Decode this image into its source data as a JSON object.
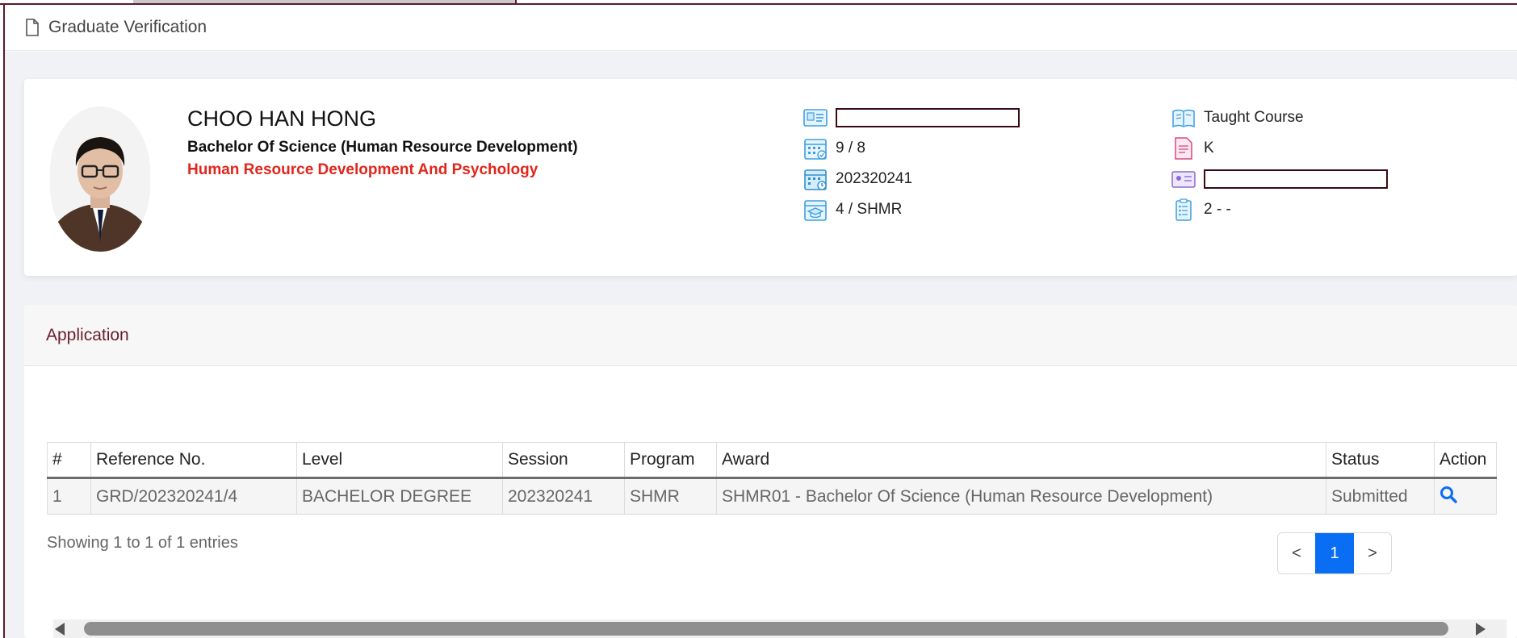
{
  "header": {
    "title": "Graduate Verification"
  },
  "profile": {
    "name": "CHOO HAN HONG",
    "degree": "Bachelor Of Science (Human Resource Development)",
    "major": "Human Resource Development And Psychology",
    "info_left": [
      {
        "icon": "id-card-icon",
        "value": ""
      },
      {
        "icon": "calendar-check-icon",
        "value": "9 / 8"
      },
      {
        "icon": "calendar-clock-icon",
        "value": "202320241"
      },
      {
        "icon": "graduation-cap-icon",
        "value": "4 / SHMR"
      }
    ],
    "info_right": [
      {
        "icon": "book-icon",
        "value": "Taught Course"
      },
      {
        "icon": "document-icon",
        "value": "K"
      },
      {
        "icon": "id-badge-icon",
        "value": ""
      },
      {
        "icon": "clipboard-list-icon",
        "value": "2 - -"
      }
    ]
  },
  "application": {
    "title": "Application",
    "columns": [
      "#",
      "Reference No.",
      "Level",
      "Session",
      "Program",
      "Award",
      "Status",
      "Action"
    ],
    "rows": [
      {
        "no": "1",
        "reference": "GRD/202320241/4",
        "level": "BACHELOR DEGREE",
        "session": "202320241",
        "program": "SHMR",
        "award": "SHMR01 - Bachelor Of Science (Human Resource Development)",
        "status": "Submitted",
        "action_icon": "search-icon"
      }
    ],
    "showing": "Showing 1 to 1 of 1 entries",
    "pagination": {
      "prev": "<",
      "current": "1",
      "next": ">"
    }
  },
  "colors": {
    "accent": "#0a6ef5",
    "brand": "#6b1d2e",
    "major": "#e0261c",
    "icon": "#3aa0e0"
  }
}
